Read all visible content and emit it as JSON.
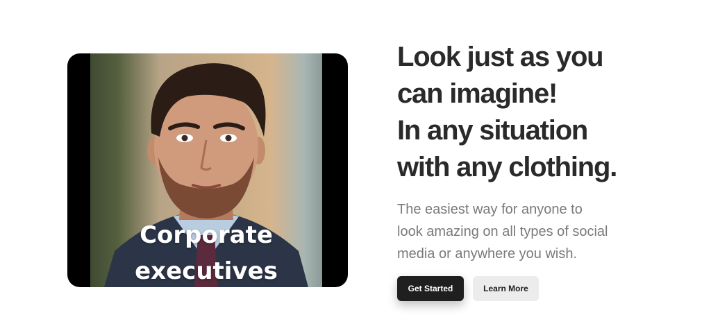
{
  "media": {
    "caption_line1": "Corporate",
    "caption_line2": "executives"
  },
  "hero": {
    "headline_lines": [
      "Look just as you",
      "can imagine!",
      "In any situation",
      "with any clothing."
    ],
    "subtitle_lines": [
      "The easiest way for anyone to",
      "look amazing on all types of social",
      "media or anywhere you wish."
    ]
  },
  "actions": {
    "primary_label": "Get Started",
    "secondary_label": "Learn More"
  },
  "colors": {
    "headline": "#2a2a2a",
    "subtitle": "#7a7a7a",
    "primary_button": "#1f1f1f",
    "secondary_button": "#ececec"
  }
}
